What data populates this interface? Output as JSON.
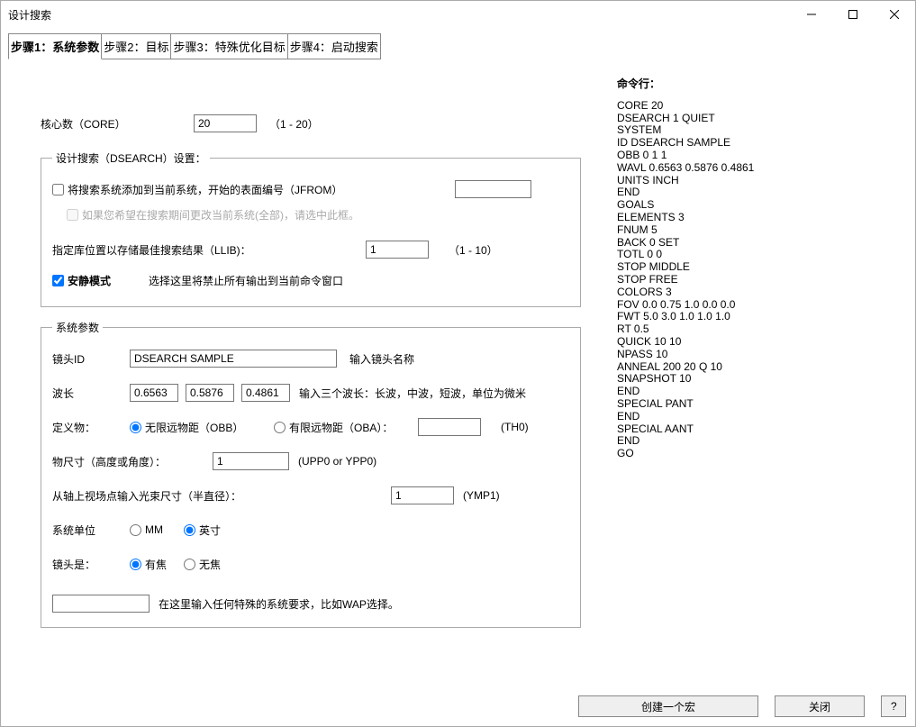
{
  "window": {
    "title": "设计搜索"
  },
  "tabs": [
    {
      "label": "步骤1：系统参数",
      "active": true
    },
    {
      "label": "步骤2：目标"
    },
    {
      "label": "步骤3：特殊优化目标"
    },
    {
      "label": "步骤4：启动搜索"
    }
  ],
  "core": {
    "label": "核心数（CORE）",
    "value": "20",
    "hint": "（1 - 20）"
  },
  "dsearch": {
    "legend": "设计搜索（DSEARCH）设置：",
    "jfrom_label": "将搜索系统添加到当前系统，开始的表面编号（JFROM）",
    "jfrom_value": "",
    "sub_hint": "如果您希望在搜索期间更改当前系统(全部)，请选中此框。",
    "llib_label": "指定库位置以存储最佳搜索结果（LLIB)：",
    "llib_value": "1",
    "llib_hint": "（1 - 10）",
    "quiet_label": "安静模式",
    "quiet_hint": "选择这里将禁止所有输出到当前命令窗口"
  },
  "sysparams": {
    "legend": "系统参数",
    "lensid_label": "镜头ID",
    "lensid_value": "DSEARCH SAMPLE",
    "lensid_hint": "输入镜头名称",
    "wavl_label": "波长",
    "wavl1": "0.6563",
    "wavl2": "0.5876",
    "wavl3": "0.4861",
    "wavl_hint": "输入三个波长：长波，中波，短波，单位为微米",
    "objdef_label": "定义物：",
    "obb_label": "无限远物距（OBB）",
    "oba_label": "有限远物距（OBA）：",
    "th0_value": "",
    "th0_hint": "(TH0)",
    "objsize_label": "物尺寸（高度或角度）：",
    "objsize_value": "1",
    "objsize_hint": "(UPP0 or YPP0)",
    "ymp1_label": "从轴上视场点输入光束尺寸（半直径）：",
    "ymp1_value": "1",
    "ymp1_hint": "(YMP1)",
    "units_label": "系统单位",
    "units_mm": "MM",
    "units_inch": "英寸",
    "lensis_label": "镜头是：",
    "focal_label": "有焦",
    "afocal_label": "无焦",
    "special_value": "",
    "special_hint": "在这里输入任何特殊的系统要求，比如WAP选择。"
  },
  "cmd": {
    "title": "命令行：",
    "lines": [
      "CORE 20",
      "DSEARCH 1 QUIET",
      "SYSTEM",
      "ID DSEARCH SAMPLE",
      "OBB 0 1 1",
      "WAVL 0.6563 0.5876 0.4861",
      "UNITS INCH",
      "END",
      "GOALS",
      "ELEMENTS 3",
      "FNUM 5",
      "BACK 0 SET",
      "TOTL 0 0",
      "STOP MIDDLE",
      "STOP FREE",
      "COLORS 3",
      "FOV 0.0 0.75 1.0 0.0 0.0",
      "FWT 5.0 3.0 1.0 1.0 1.0",
      "RT 0.5",
      "QUICK 10 10",
      "NPASS 10",
      "ANNEAL 200 20 Q 10",
      "SNAPSHOT 10",
      "END",
      "SPECIAL PANT",
      "END",
      "SPECIAL AANT",
      "END",
      "GO"
    ]
  },
  "footer": {
    "create_macro": "创建一个宏",
    "close": "关闭",
    "help": "?"
  }
}
